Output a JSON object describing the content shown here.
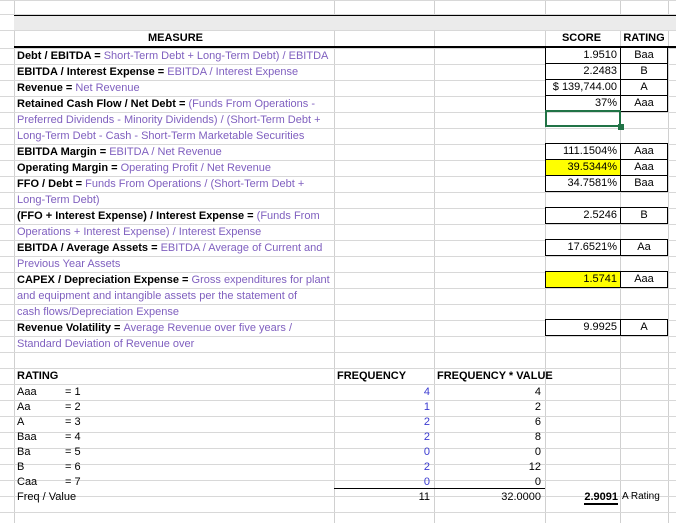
{
  "table": {
    "headers": {
      "measure": "MEASURE",
      "score": "SCORE",
      "rating": "RATING"
    },
    "rows": [
      {
        "label": "Debt / EBITDA",
        "eq": " = ",
        "formula": "Short-Term Debt + Long-Term Debt) / EBITDA",
        "score": "1.9510",
        "rating": "Baa",
        "highlight": false
      },
      {
        "label": "EBITDA / Interest Expense",
        "eq": " = ",
        "formula": "EBITDA / Interest Expense",
        "score": "2.2483",
        "rating": "B",
        "highlight": false
      },
      {
        "label": "Revenue",
        "eq": " = ",
        "formula": "Net Revenue",
        "score": "$ 139,744.00",
        "rating": "A",
        "highlight": false
      },
      {
        "label": "Retained Cash Flow / Net Debt",
        "eq": " = ",
        "formula": "(Funds From Operations -",
        "score": "37%",
        "rating": "Aaa",
        "highlight": false
      },
      {
        "label": "",
        "eq": "",
        "formula": "Preferred Dividends - Minority Dividends) / (Short-Term Debt +",
        "score": "",
        "rating": "",
        "highlight": false
      },
      {
        "label": "",
        "eq": "",
        "formula": "Long-Term Debt - Cash - Short-Term Marketable Securities",
        "score": "",
        "rating": "",
        "highlight": false
      },
      {
        "label": "EBITDA Margin",
        "eq": " = ",
        "formula": "EBITDA / Net Revenue",
        "score": "111.1504%",
        "rating": "Aaa",
        "highlight": false
      },
      {
        "label": "Operating Margin",
        "eq": " = ",
        "formula": "Operating Profit / Net Revenue",
        "score": "39.5344%",
        "rating": "Aaa",
        "highlight": true
      },
      {
        "label": "FFO / Debt",
        "eq": " = ",
        "formula": "Funds From Operations / (Short-Term Debt +",
        "score": "34.7581%",
        "rating": "Baa",
        "highlight": false
      },
      {
        "label": "",
        "eq": "",
        "formula": " Long-Term Debt)",
        "score": "",
        "rating": "",
        "highlight": false
      },
      {
        "label": "(FFO + Interest Expense) / Interest Expense",
        "eq": " = ",
        "formula": "(Funds From",
        "score": "2.5246",
        "rating": "B",
        "highlight": false
      },
      {
        "label": "",
        "eq": "",
        "formula": "Operations + Interest Expense) / Interest Expense",
        "score": "",
        "rating": "",
        "highlight": false
      },
      {
        "label": "EBITDA / Average Assets",
        "eq": " = ",
        "formula": "EBITDA / Average of Current and",
        "score": "17.6521%",
        "rating": "Aa",
        "highlight": false
      },
      {
        "label": "",
        "eq": "",
        "formula": "Previous Year Assets",
        "score": "",
        "rating": "",
        "highlight": false
      },
      {
        "label": "CAPEX / Depreciation Expense",
        "eq": " = ",
        "formula": "Gross expenditures for plant",
        "score": "1.5741",
        "rating": "Aaa",
        "highlight": true
      },
      {
        "label": "",
        "eq": "",
        "formula": "and equipment and intangible assets per the statement of",
        "score": "",
        "rating": "",
        "highlight": false
      },
      {
        "label": "",
        "eq": "",
        "formula": "cash flows/Depreciation Expense",
        "score": "",
        "rating": "",
        "highlight": false
      },
      {
        "label": "Revenue Volatility",
        "eq": " = ",
        "formula": "Average Revenue over five years /",
        "score": "9.9925",
        "rating": "A",
        "highlight": false
      },
      {
        "label": "",
        "eq": "",
        "formula": " Standard Deviation of Revenue over",
        "score": "",
        "rating": "",
        "highlight": false
      }
    ]
  },
  "summary": {
    "headers": {
      "rating": "RATING",
      "frequency": "FREQUENCY",
      "freq_value": "FREQUENCY * VALUE"
    },
    "rows": [
      {
        "code": "Aaa",
        "value": "= 1",
        "frequency": "4",
        "freq_value": "4"
      },
      {
        "code": "Aa",
        "value": "= 2",
        "frequency": "1",
        "freq_value": "2"
      },
      {
        "code": "A",
        "value": "= 3",
        "frequency": "2",
        "freq_value": "6"
      },
      {
        "code": "Baa",
        "value": "= 4",
        "frequency": "2",
        "freq_value": "8"
      },
      {
        "code": "Ba",
        "value": "= 5",
        "frequency": "0",
        "freq_value": "0"
      },
      {
        "code": "B",
        "value": "= 6",
        "frequency": "2",
        "freq_value": "12"
      },
      {
        "code": "Caa",
        "value": "= 7",
        "frequency": "0",
        "freq_value": "0"
      }
    ],
    "total": {
      "label": "Freq / Value",
      "frequency": "11",
      "freq_value": "32.0000",
      "result": "2.9091",
      "result_rating": "A Rating"
    }
  },
  "colors": {
    "formula_text": "#7f5fbf",
    "highlight": "#ffff00",
    "selection": "#217346",
    "frequency_text": "#3a3ad0",
    "header_band": "#ebebeb"
  }
}
